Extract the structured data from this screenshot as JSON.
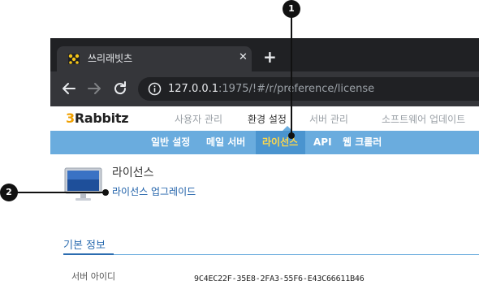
{
  "browser": {
    "tab_title": "쓰리래빗츠",
    "tab_close": "✕",
    "new_tab": "+",
    "url_host": "127.0.0.1",
    "url_path": ":1975/!#/r/preference/license"
  },
  "app": {
    "logo_digit": "3",
    "logo_text": "Rabbitz",
    "main_nav": {
      "user_mgmt": "사용자 관리",
      "preferences": "환경 설정",
      "server_mgmt": "서버 관리",
      "software_update": "소프트웨어 업데이트"
    },
    "sub_nav": {
      "general": "일반 설정",
      "mail_server": "메일 서버",
      "license": "라이선스",
      "api": "API",
      "web_crawler": "웹 크롤러"
    }
  },
  "page": {
    "title": "라이선스",
    "upgrade_link": "라이선스 업그레이드",
    "section_title": "기본 정보",
    "server_id_label": "서버 아이디",
    "server_id_value": "9C4EC22F-35E8-2FA3-55F6-E43C66611B46"
  },
  "callouts": {
    "one": "1",
    "two": "2"
  },
  "colors": {
    "tab_strip": "#202124",
    "toolbar": "#35363a",
    "sub_nav": "#6aacde",
    "active_sub_nav_text": "#ffd84a",
    "logo_accent": "#f0a000",
    "link": "#1d5fa8"
  },
  "icons": {
    "favicon": "rabbit-favicon-icon",
    "back": "arrow-left-icon",
    "forward": "arrow-right-icon",
    "reload": "reload-icon",
    "info": "info-icon",
    "monitor": "monitor-icon"
  }
}
